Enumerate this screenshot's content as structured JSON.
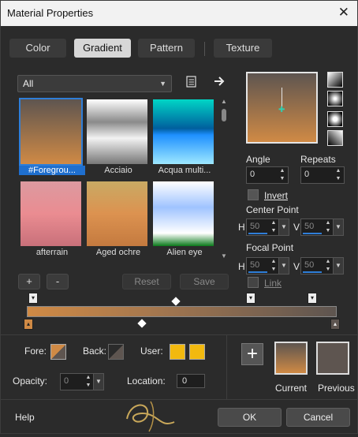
{
  "window": {
    "title": "Material Properties",
    "close_glyph": "✕"
  },
  "tabs": [
    {
      "label": "Color"
    },
    {
      "label": "Gradient"
    },
    {
      "label": "Pattern"
    },
    {
      "label": "Texture"
    }
  ],
  "active_tab": "Gradient",
  "category": {
    "value": "All"
  },
  "gallery": {
    "items": [
      {
        "label": "#Foregrou...",
        "gradient": [
          "#5e5550",
          "#d08a45"
        ],
        "selected": true
      },
      {
        "label": "Acciaio",
        "gradient": [
          "#ffffff",
          "#8a8a8a",
          "#f2f2f2",
          "#777777"
        ],
        "selected": false
      },
      {
        "label": "Acqua multi...",
        "gradient": [
          "#00d6c6",
          "#005f9e",
          "#1e90ff",
          "#9ee8ff"
        ],
        "selected": false
      },
      {
        "label": "afterrain",
        "gradient": [
          "#dc9aa0",
          "#ea8c91",
          "#c8707a"
        ],
        "selected": false
      },
      {
        "label": "Aged ochre",
        "gradient": [
          "#c9aa64",
          "#dc9250",
          "#c47a3f"
        ],
        "selected": false
      },
      {
        "label": "Alien eye",
        "gradient": [
          "#ffffff",
          "#9fc3ff",
          "#ffffff",
          "#0a7a1a"
        ],
        "selected": false
      }
    ]
  },
  "gallery_buttons": {
    "add": "+",
    "remove": "-",
    "reset": "Reset",
    "save": "Save"
  },
  "angle": {
    "label": "Angle",
    "value": "0"
  },
  "repeats": {
    "label": "Repeats",
    "value": "0"
  },
  "invert": {
    "label": "Invert",
    "checked": false
  },
  "center_point": {
    "label": "Center Point",
    "h_label": "H",
    "h": "50",
    "v_label": "V",
    "v": "50"
  },
  "focal_point": {
    "label": "Focal Point",
    "h_label": "H",
    "h": "50",
    "v_label": "V",
    "v": "50"
  },
  "link": {
    "label": "Link",
    "checked": false
  },
  "gradient_colors": {
    "start": "#d08a45",
    "end": "#5e5550"
  },
  "fore": {
    "label": "Fore:",
    "color": "#d08a45"
  },
  "back": {
    "label": "Back:",
    "color": "#5e5550"
  },
  "user": {
    "label": "User:",
    "color1": "#f2b90f",
    "color2": "#f2b90f"
  },
  "opacity": {
    "label": "Opacity:",
    "value": "0"
  },
  "location": {
    "label": "Location:",
    "value": "0"
  },
  "current": {
    "label": "Current"
  },
  "previous": {
    "label": "Previous"
  },
  "footer": {
    "help": "Help",
    "ok": "OK",
    "cancel": "Cancel",
    "add_glyph": "+"
  }
}
